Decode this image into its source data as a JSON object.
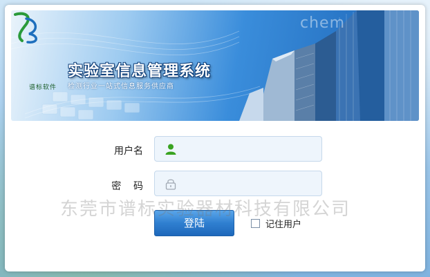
{
  "banner": {
    "title": "实验室信息管理系统",
    "subtitle": "检测行业一站式信息服务供应商",
    "logo_caption": "谱标软件",
    "brand_watermark": "chem"
  },
  "form": {
    "username_label": "用户名",
    "password_label": "密    码",
    "username_value": "",
    "password_value": "",
    "login_label": "登陆",
    "remember_label": "记住用户",
    "remember_checked": false
  },
  "watermark": "东莞市谱标实验器材科技有限公司",
  "icons": {
    "user": "user-icon",
    "lock": "lock-icon"
  },
  "colors": {
    "accent": "#2f7fd0",
    "user_icon": "#3aa321"
  }
}
